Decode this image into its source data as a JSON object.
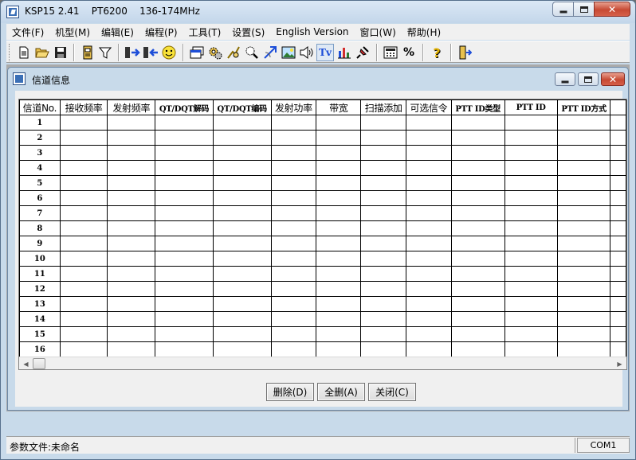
{
  "app": {
    "title": "KSP15 2.41    PT6200    136-174MHz"
  },
  "menu": [
    {
      "label": "文件(F)"
    },
    {
      "label": "机型(M)"
    },
    {
      "label": "编辑(E)"
    },
    {
      "label": "编程(P)"
    },
    {
      "label": "工具(T)"
    },
    {
      "label": "设置(S)"
    },
    {
      "label": "English Version"
    },
    {
      "label": "窗口(W)"
    },
    {
      "label": "帮助(H)"
    }
  ],
  "toolbar": {
    "icons": [
      "new-file-icon",
      "open-folder-icon",
      "save-icon",
      "channel-info-icon",
      "filter-icon",
      "read-radio-icon",
      "write-radio-icon",
      "smiley-icon",
      "window-icon",
      "gears-icon",
      "scan-icon",
      "search-icon",
      "signal-icon",
      "picture-icon",
      "speaker-icon",
      "tv-icon",
      "bar-chart-icon",
      "pin-icon",
      "calculator-icon",
      "percent-icon",
      "help-icon",
      "exit-icon"
    ],
    "percent_glyph": "%",
    "help_glyph": "?",
    "tv_glyph": "Tv"
  },
  "child_window": {
    "title": "信道信息"
  },
  "grid": {
    "columns": [
      "信道No.",
      "接收频率",
      "发射频率",
      "QT/DQT解码",
      "QT/DQT编码",
      "发射功率",
      "带宽",
      "扫描添加",
      "可选信令",
      "PTT ID类型",
      "PTT ID",
      "PTT ID方式"
    ],
    "rows": [
      "1",
      "2",
      "3",
      "4",
      "5",
      "6",
      "7",
      "8",
      "9",
      "10",
      "11",
      "12",
      "13",
      "14",
      "15",
      "16"
    ]
  },
  "buttons": {
    "delete": "删除(D)",
    "delete_all": "全删(A)",
    "close": "关闭(C)"
  },
  "status": {
    "param_file": "参数文件:未命名",
    "port": "COM1"
  }
}
